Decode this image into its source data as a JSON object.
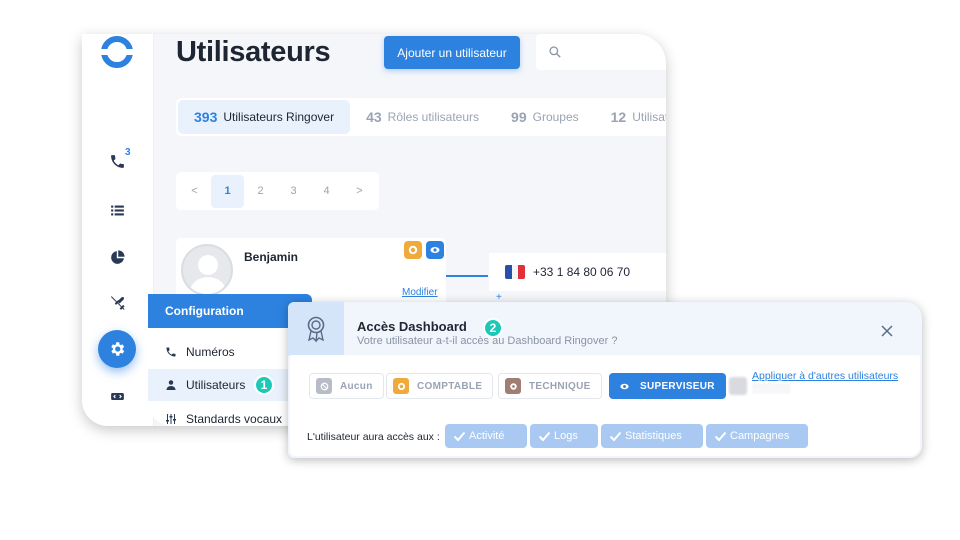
{
  "header": {
    "title": "Utilisateurs",
    "add_button": "Ajouter un utilisateur"
  },
  "rail": {
    "calls_badge": "3"
  },
  "tabs": [
    {
      "count": "393",
      "label": "Utilisateurs Ringover"
    },
    {
      "count": "43",
      "label": "Rôles utilisateurs"
    },
    {
      "count": "99",
      "label": "Groupes"
    },
    {
      "count": "12",
      "label": "Utilisat"
    }
  ],
  "pagination": {
    "prev": "<",
    "pages": [
      "1",
      "2",
      "3",
      "4"
    ],
    "next": ">",
    "current": "1"
  },
  "user_card": {
    "name": "Benjamin",
    "modify_link": "Modifier",
    "phone": "+33 1 84 80 06 70",
    "plus": "+"
  },
  "config_menu": {
    "header": "Configuration",
    "items": [
      "Numéros",
      "Utilisateurs",
      "Standards vocaux"
    ],
    "active": "Utilisateurs"
  },
  "steps": {
    "one": "1",
    "two": "2"
  },
  "access_modal": {
    "title": "Accès Dashboard",
    "subtitle": "Votre utilisateur a-t-il accès au Dashboard Ringover ?",
    "roles": [
      "Aucun",
      "COMPTABLE",
      "TECHNIQUE",
      "SUPERVISEUR"
    ],
    "selected_role": "SUPERVISEUR",
    "apply_link": "Appliquer à d'autres utilisateurs",
    "access_label": "L'utilisateur aura accès aux :",
    "permissions": [
      "Activité",
      "Logs",
      "Statistiques",
      "Campagnes"
    ]
  },
  "colors": {
    "accent": "#2d82e0",
    "step_badge": "#1bc9b6",
    "comptable": "#f0a93b",
    "technique": "#a07e74",
    "aucun": "#b7bcc6",
    "permission_chip": "#a9c9f2"
  }
}
